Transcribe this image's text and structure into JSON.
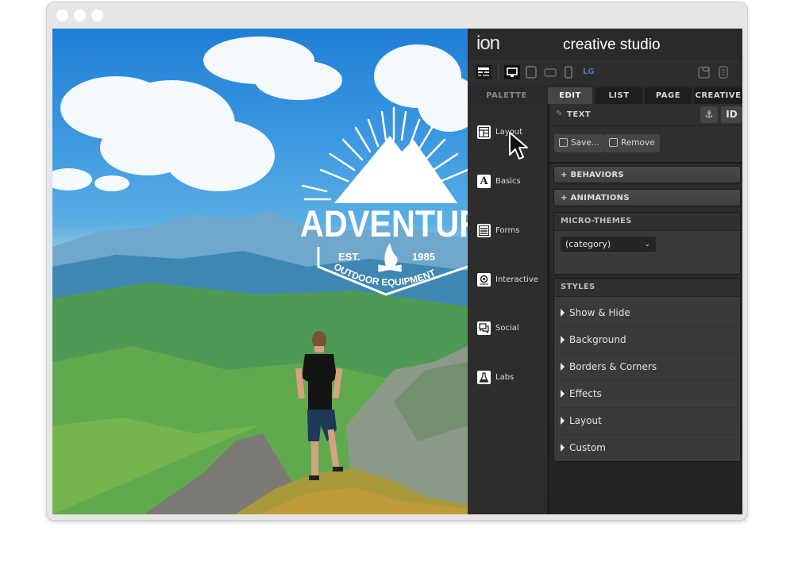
{
  "window": {
    "controls": [
      "close",
      "minimize",
      "maximize"
    ]
  },
  "photo": {
    "badge": {
      "title": "ADVENTUR",
      "est": "EST.",
      "year": "1985",
      "subtitle": "OUTDOOR EQUIPMENT"
    }
  },
  "panel": {
    "logo": "ion",
    "title": "creative studio",
    "toolbar": {
      "icons": [
        "layout-toggle-icon",
        "desktop-icon",
        "tablet-icon",
        "tablet-landscape-icon",
        "phone-icon",
        "preview-icon",
        "page-icon"
      ],
      "breakpoint": "LG"
    },
    "tabs": [
      {
        "label": "PALETTE",
        "active": false
      },
      {
        "label": "EDIT",
        "active": true
      },
      {
        "label": "LIST",
        "active": false
      },
      {
        "label": "PAGE",
        "active": false
      },
      {
        "label": "CREATIVE",
        "active": false
      }
    ],
    "palette": [
      {
        "label": "Layout",
        "icon": "layout-icon"
      },
      {
        "label": "Basics",
        "icon": "basics-icon",
        "glyph": "A"
      },
      {
        "label": "Forms",
        "icon": "forms-icon"
      },
      {
        "label": "Interactive",
        "icon": "interactive-icon"
      },
      {
        "label": "Social",
        "icon": "social-icon"
      },
      {
        "label": "Labs",
        "icon": "labs-icon"
      }
    ],
    "edit": {
      "element_type": "TEXT",
      "anchor_button": "⚓",
      "id_button": "ID",
      "save_label": "Save...",
      "remove_label": "Remove",
      "behaviors_label": "+ BEHAVIORS",
      "animations_label": "+ ANIMATIONS",
      "micro_themes": {
        "header": "MICRO-THEMES",
        "select_value": "(category)"
      },
      "styles": {
        "header": "STYLES",
        "items": [
          "Show & Hide",
          "Background",
          "Borders & Corners",
          "Effects",
          "Layout",
          "Custom"
        ]
      }
    },
    "colors": {
      "accent_blue": "#4b77b6",
      "panel_bg": "#2b2b2b"
    }
  }
}
